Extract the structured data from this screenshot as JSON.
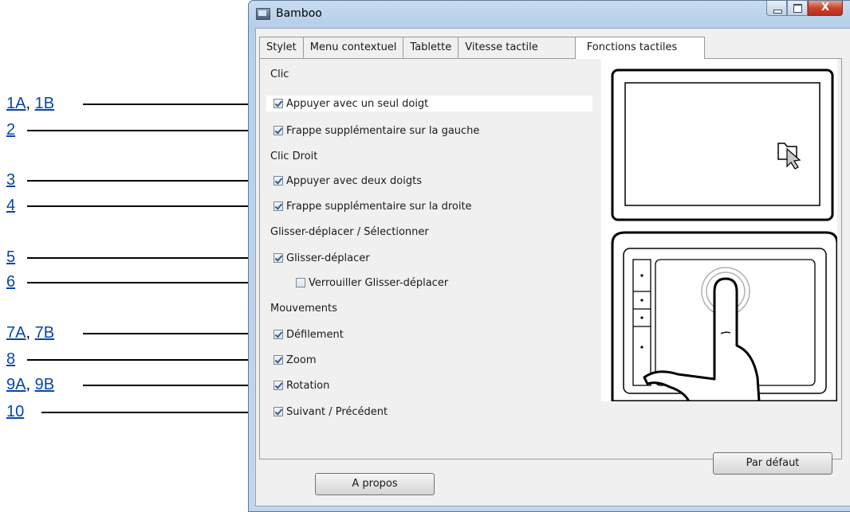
{
  "window": {
    "title": "Bamboo",
    "close_glyph": "X"
  },
  "tabs": [
    {
      "label": "Stylet"
    },
    {
      "label": "Menu contextuel"
    },
    {
      "label": "Tablette"
    },
    {
      "label": "Vitesse tactile"
    },
    {
      "label": "Fonctions tactiles",
      "active": true
    }
  ],
  "groups": {
    "clic": "Clic",
    "clic_droit": "Clic Droit",
    "glisser": "Glisser-déplacer / Sélectionner",
    "mouvements": "Mouvements"
  },
  "options": [
    {
      "label": "Appuyer avec un seul doigt",
      "checked": true
    },
    {
      "label": "Frappe supplémentaire sur la gauche",
      "checked": true
    },
    {
      "label": "Appuyer avec deux doigts",
      "checked": true
    },
    {
      "label": "Frappe supplémentaire sur la droite",
      "checked": true
    },
    {
      "label": "Glisser-déplacer",
      "checked": true
    },
    {
      "label": "Verrouiller Glisser-déplacer",
      "checked": false
    },
    {
      "label": "Défilement",
      "checked": true
    },
    {
      "label": "Zoom",
      "checked": true
    },
    {
      "label": "Rotation",
      "checked": true
    },
    {
      "label": "Suivant / Précédent",
      "checked": true
    }
  ],
  "buttons": {
    "default": "Par défaut",
    "about": "A propos"
  },
  "callouts": [
    {
      "a": "1A",
      "b": "1B"
    },
    {
      "a": "2"
    },
    {
      "a": "3"
    },
    {
      "a": "4"
    },
    {
      "a": "5"
    },
    {
      "a": "6"
    },
    {
      "a": "7A",
      "b": "7B"
    },
    {
      "a": "8"
    },
    {
      "a": "9A",
      "b": "9B"
    },
    {
      "a": "10"
    }
  ],
  "callout_separator": ", ",
  "icons": {
    "app": "bamboo-app-icon",
    "illustration_top": "folder-cursor-icon",
    "illustration_bottom": "tablet-finger-tap-illustration"
  }
}
